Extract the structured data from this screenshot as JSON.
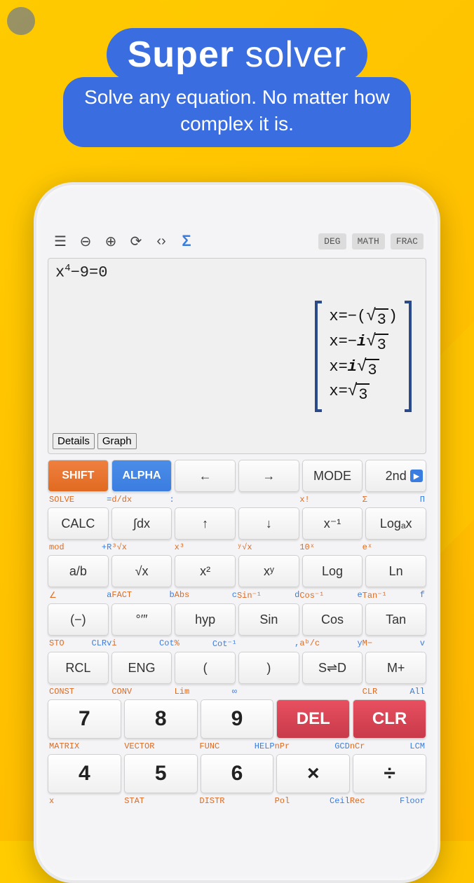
{
  "hero": {
    "title_bold": "Super",
    "title_light": " solver",
    "subtitle": "Solve any equation. No matter how\ncomplex it is."
  },
  "toolbar": {
    "sigma": "Σ",
    "modes": [
      "DEG",
      "MATH",
      "FRAC"
    ]
  },
  "display": {
    "equation_base": "x",
    "equation_exp": "4",
    "equation_rest": "−9=0",
    "solutions": [
      {
        "prefix": "x=−(",
        "sqrt": "3",
        "suffix": ")"
      },
      {
        "prefix": "x=−",
        "i": true,
        "sqrt": "3",
        "suffix": ""
      },
      {
        "prefix": "x=",
        "i": true,
        "sqrt": "3",
        "suffix": ""
      },
      {
        "prefix": "x=",
        "sqrt": "3",
        "suffix": ""
      }
    ],
    "buttons": [
      "Details",
      "Graph"
    ]
  },
  "hints": {
    "r1": [
      [
        "SOLVE",
        "="
      ],
      [
        "d/dx",
        ":"
      ],
      [
        "",
        ""
      ],
      [
        "",
        ""
      ],
      [
        "x!",
        ""
      ],
      [
        "Σ",
        "Π"
      ]
    ],
    "r2": [
      [
        "mod",
        "+R"
      ],
      [
        "³√x",
        ""
      ],
      [
        "x³",
        ""
      ],
      [
        "ʸ√x",
        ""
      ],
      [
        "10ˣ",
        ""
      ],
      [
        "eˣ",
        ""
      ]
    ],
    "r3": [
      [
        "∠",
        "a"
      ],
      [
        "FACT",
        "b"
      ],
      [
        "Abs",
        "c"
      ],
      [
        "Sin⁻¹",
        "d"
      ],
      [
        "Cos⁻¹",
        "e"
      ],
      [
        "Tan⁻¹",
        "f"
      ]
    ],
    "r4": [
      [
        "STO",
        "CLRv"
      ],
      [
        "i",
        "Cot"
      ],
      [
        "%",
        "Cot⁻¹"
      ],
      [
        "",
        ","
      ],
      [
        "aᵇ/c",
        "y"
      ],
      [
        "M−",
        "v"
      ]
    ],
    "r5": [
      [
        "CONST",
        ""
      ],
      [
        "CONV",
        ""
      ],
      [
        "Lim",
        "∞"
      ],
      [
        "",
        ""
      ],
      [
        "",
        ""
      ],
      [
        "CLR",
        "All"
      ]
    ],
    "r6": [
      [
        "MATRIX",
        ""
      ],
      [
        "VECTOR",
        ""
      ],
      [
        "FUNC",
        "HELP"
      ],
      [
        "nPr",
        "GCD"
      ],
      [
        "nCr",
        "LCM"
      ]
    ],
    "r7": [
      [
        "x",
        ""
      ],
      [
        "STAT",
        ""
      ],
      [
        "DISTR",
        ""
      ],
      [
        "Pol",
        "Ceil"
      ],
      [
        "Rec",
        "Floor"
      ]
    ]
  },
  "keys": {
    "r0": [
      "SHIFT",
      "ALPHA",
      "←",
      "→",
      "MODE",
      "2nd"
    ],
    "r1": [
      "CALC",
      "∫dx",
      "↑",
      "↓",
      "x⁻¹",
      "Logₐx"
    ],
    "r2": [
      "a/b",
      "√x",
      "x²",
      "xʸ",
      "Log",
      "Ln"
    ],
    "r3": [
      "(−)",
      "°′″",
      "hyp",
      "Sin",
      "Cos",
      "Tan"
    ],
    "r4": [
      "RCL",
      "ENG",
      "(",
      ")",
      "S⇌D",
      "M+"
    ],
    "r5": [
      "7",
      "8",
      "9",
      "DEL",
      "CLR"
    ],
    "r6": [
      "4",
      "5",
      "6",
      "×",
      "÷"
    ]
  }
}
